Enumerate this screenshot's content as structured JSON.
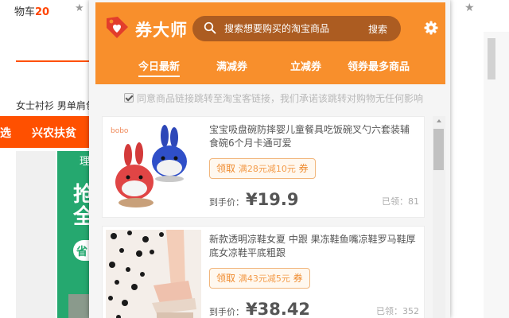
{
  "background": {
    "cart_label": "物车",
    "cart_count": "20",
    "star": "★",
    "category_text": "女士衬衫  男单肩包",
    "nav_items": [
      "选",
      "兴农扶贫"
    ],
    "banner": {
      "t1": "理",
      "t2": "抢",
      "t3": "全",
      "t4": "省"
    }
  },
  "popup": {
    "brand": "券大师",
    "search": {
      "placeholder": "搜索想要购买的淘宝商品",
      "button": "搜索"
    },
    "tabs": [
      "今日最新",
      "满减券",
      "立减券",
      "领券最多商品"
    ],
    "notice": "同意商品链接跳转至淘宝客链接，我们承诺该跳转对购物无任何影响",
    "notice_checked": true,
    "icons": {
      "logo": "tag-heart-icon",
      "search": "search-icon",
      "settings": "gear-icon"
    },
    "products": [
      {
        "title": "宝宝吸盘碗防摔婴儿童餐具吃饭碗叉勺六套装辅食碗6个月卡通可爱",
        "coupon_prefix": "领取",
        "coupon_amount": "满28元减10元",
        "coupon_suffix": "券",
        "price_label": "到手价：",
        "price": "¥19.9",
        "claimed": "已领：81",
        "image_brand_text": "bobo"
      },
      {
        "title": "新款透明凉鞋女夏 中跟 果冻鞋鱼嘴凉鞋罗马鞋厚底女凉鞋平底粗跟",
        "coupon_prefix": "领取",
        "coupon_amount": "满43元减5元",
        "coupon_suffix": "券",
        "price_label": "到手价：",
        "price": "¥38.42",
        "claimed": "已领：352"
      }
    ]
  }
}
